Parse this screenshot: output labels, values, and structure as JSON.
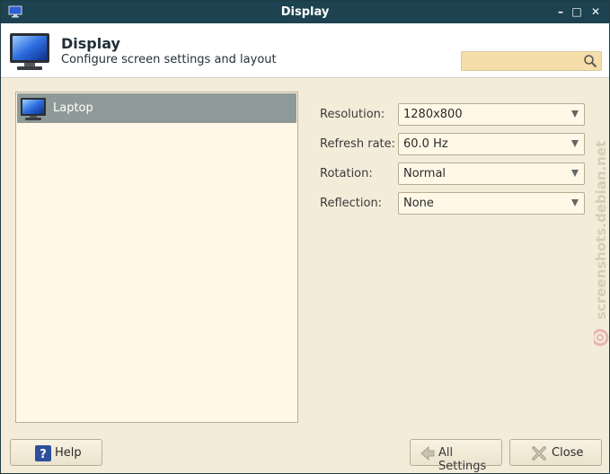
{
  "window": {
    "title": "Display"
  },
  "titlebar_buttons": {
    "minimize": "–",
    "maximize": "□",
    "close": "✕"
  },
  "header": {
    "title": "Display",
    "subtitle": "Configure screen settings and layout",
    "icon": "monitor-icon"
  },
  "search": {
    "value": "",
    "placeholder": "",
    "icon": "magnifier-icon"
  },
  "displays": [
    {
      "label": "Laptop",
      "icon": "monitor-icon",
      "selected": true
    }
  ],
  "settings": {
    "resolution": {
      "label": "Resolution:",
      "value": "1280x800"
    },
    "refresh_rate": {
      "label": "Refresh rate:",
      "value": "60.0 Hz"
    },
    "rotation": {
      "label": "Rotation:",
      "value": "Normal"
    },
    "reflection": {
      "label": "Reflection:",
      "value": "None"
    }
  },
  "buttons": {
    "help": "Help",
    "all_settings": "All Settings",
    "close": "Close"
  },
  "watermark": "screenshots.debian.net",
  "colors": {
    "titlebar": "#1d4350",
    "window_bg": "#f3ecd9",
    "selection": "#8e9a98",
    "search_bg": "#f5deaa"
  }
}
